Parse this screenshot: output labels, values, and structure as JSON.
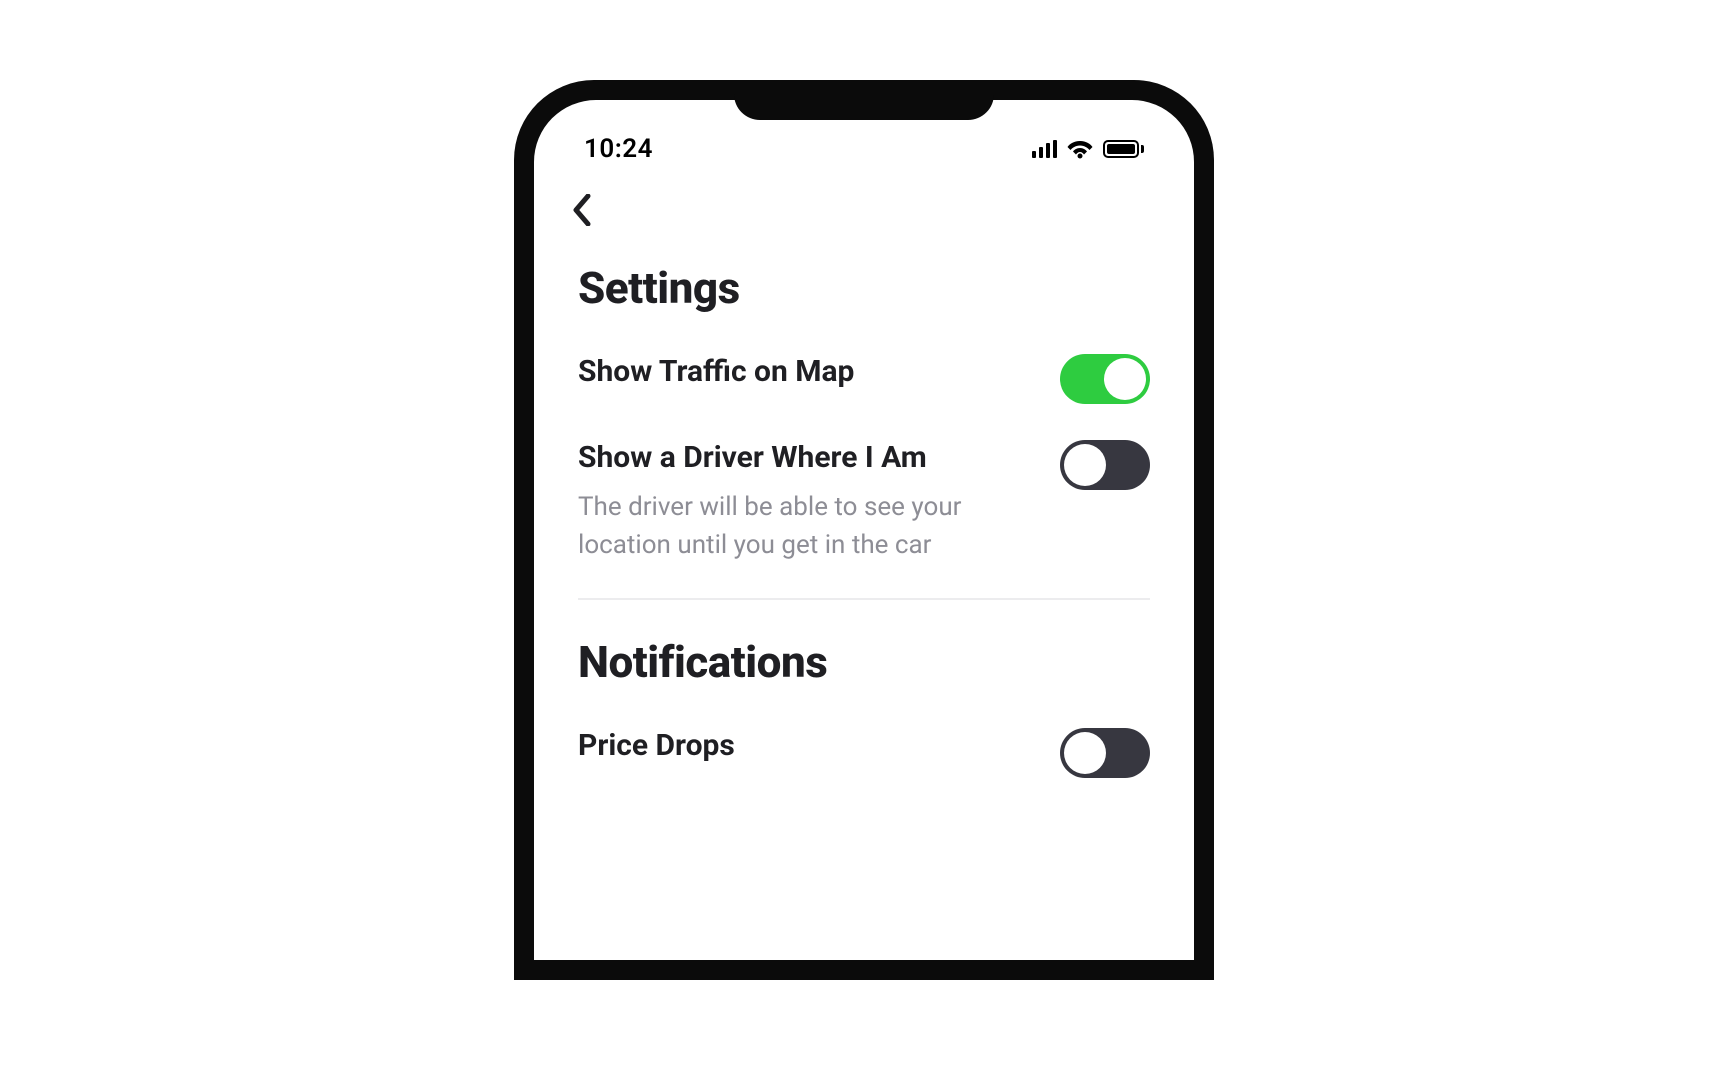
{
  "status_bar": {
    "time": "10:24"
  },
  "sections": {
    "settings": {
      "title": "Settings",
      "items": [
        {
          "label": "Show Traffic on Map",
          "desc": "",
          "enabled": true
        },
        {
          "label": "Show a Driver Where I Am",
          "desc": "The driver will be able to see your location until you get in the car",
          "enabled": false
        }
      ]
    },
    "notifications": {
      "title": "Notifications",
      "items": [
        {
          "label": "Price Drops",
          "desc": "",
          "enabled": false
        }
      ]
    }
  },
  "colors": {
    "toggle_on": "#2ecc40",
    "toggle_off": "#373740",
    "text_primary": "#1f1f23",
    "text_secondary": "#8d8d95"
  }
}
